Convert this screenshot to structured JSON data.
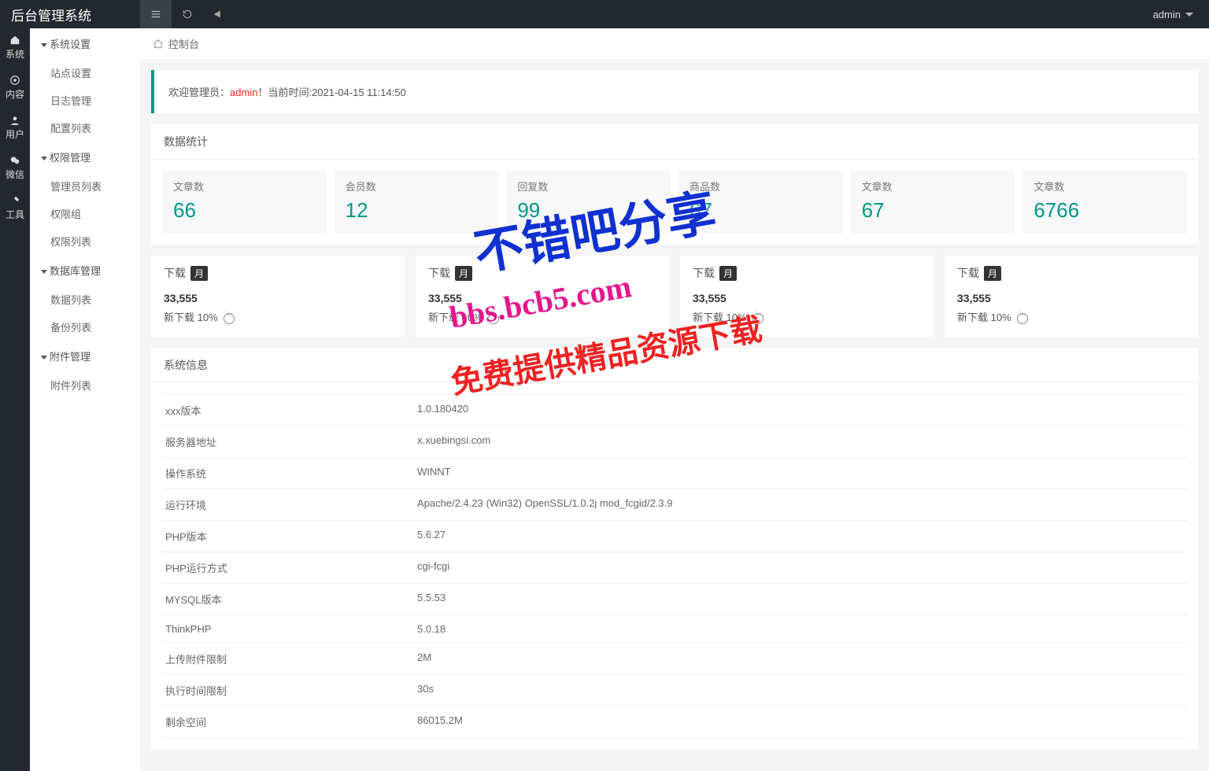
{
  "header": {
    "logo": "后台管理系统",
    "user": "admin"
  },
  "nav": [
    {
      "label": "系统"
    },
    {
      "label": "内容"
    },
    {
      "label": "用户"
    },
    {
      "label": "微信"
    },
    {
      "label": "工具"
    }
  ],
  "side": [
    {
      "title": "系统设置",
      "items": [
        "站点设置",
        "日志管理",
        "配置列表"
      ]
    },
    {
      "title": "权限管理",
      "items": [
        "管理员列表",
        "权限组",
        "权限列表"
      ]
    },
    {
      "title": "数据库管理",
      "items": [
        "数据列表",
        "备份列表"
      ]
    },
    {
      "title": "附件管理",
      "items": [
        "附件列表"
      ]
    }
  ],
  "crumb": "控制台",
  "alert": {
    "pre": "欢迎管理员：",
    "user": "admin",
    "post": "！当前时间:2021-04-15 11:14:50"
  },
  "statsTitle": "数据统计",
  "stats": [
    {
      "label": "文章数",
      "value": "66"
    },
    {
      "label": "会员数",
      "value": "12"
    },
    {
      "label": "回复数",
      "value": "99"
    },
    {
      "label": "商品数",
      "value": "67"
    },
    {
      "label": "文章数",
      "value": "67"
    },
    {
      "label": "文章数",
      "value": "6766"
    }
  ],
  "dl": {
    "title": "下载",
    "badge": "月",
    "num": "33,555",
    "sub": "新下载 10%"
  },
  "sysTitle": "系统信息",
  "sysrows": [
    {
      "k": "xxx版本",
      "v": "1.0.180420"
    },
    {
      "k": "服务器地址",
      "v": "x.xuebingsi.com"
    },
    {
      "k": "操作系统",
      "v": "WINNT"
    },
    {
      "k": "运行环境",
      "v": "Apache/2.4.23 (Win32) OpenSSL/1.0.2j mod_fcgid/2.3.9"
    },
    {
      "k": "PHP版本",
      "v": "5.6.27"
    },
    {
      "k": "PHP运行方式",
      "v": "cgi-fcgi"
    },
    {
      "k": "MYSQL版本",
      "v": "5.5.53"
    },
    {
      "k": "ThinkPHP",
      "v": "5.0.18"
    },
    {
      "k": "上传附件限制",
      "v": "2M"
    },
    {
      "k": "执行时间限制",
      "v": "30s"
    },
    {
      "k": "剩余空间",
      "v": "86015.2M"
    }
  ],
  "watermark": {
    "line1": "不错吧分享",
    "line2": "bbs.bcb5.com",
    "line3": "免费提供精品资源下载"
  }
}
